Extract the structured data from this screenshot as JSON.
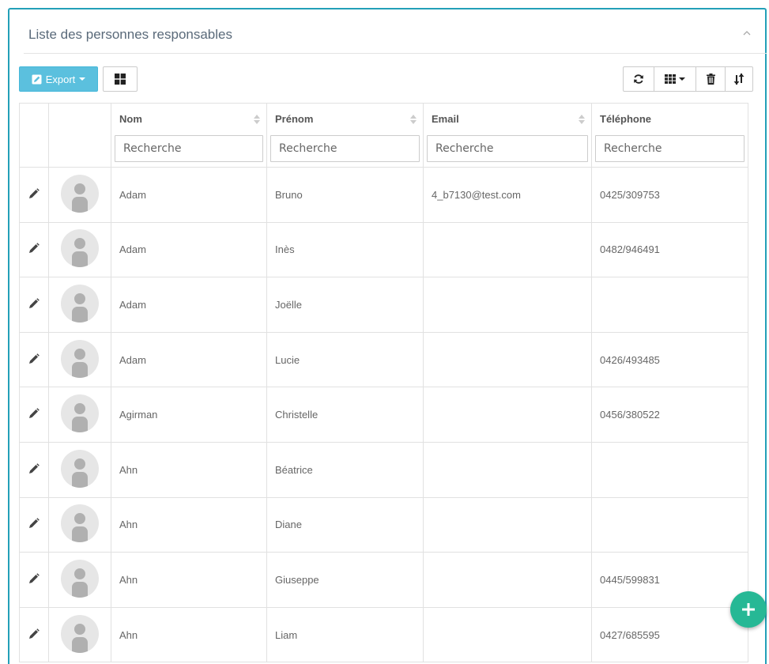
{
  "panel": {
    "title": "Liste des personnes responsables"
  },
  "toolbar": {
    "export_label": "Export",
    "right_buttons": [
      "refresh-icon",
      "columns-icon",
      "trash-icon",
      "sort-icon"
    ]
  },
  "table": {
    "columns": [
      "Nom",
      "Prénom",
      "Email",
      "Téléphone"
    ],
    "filter_placeholder": "Recherche",
    "rows": [
      {
        "nom": "Adam",
        "prenom": "Bruno",
        "email": "4_b7130@test.com",
        "telephone": "0425/309753"
      },
      {
        "nom": "Adam",
        "prenom": "Inès",
        "email": "",
        "telephone": "0482/946491"
      },
      {
        "nom": "Adam",
        "prenom": "Joëlle",
        "email": "",
        "telephone": ""
      },
      {
        "nom": "Adam",
        "prenom": "Lucie",
        "email": "",
        "telephone": "0426/493485"
      },
      {
        "nom": "Agirman",
        "prenom": "Christelle",
        "email": "",
        "telephone": "0456/380522"
      },
      {
        "nom": "Ahn",
        "prenom": "Béatrice",
        "email": "",
        "telephone": ""
      },
      {
        "nom": "Ahn",
        "prenom": "Diane",
        "email": "",
        "telephone": ""
      },
      {
        "nom": "Ahn",
        "prenom": "Giuseppe",
        "email": "",
        "telephone": "0445/599831"
      },
      {
        "nom": "Ahn",
        "prenom": "Liam",
        "email": "",
        "telephone": "0427/685595"
      }
    ]
  },
  "colors": {
    "accent": "#5bc0de",
    "panel_border": "#23a0b8",
    "fab": "#26b895"
  }
}
